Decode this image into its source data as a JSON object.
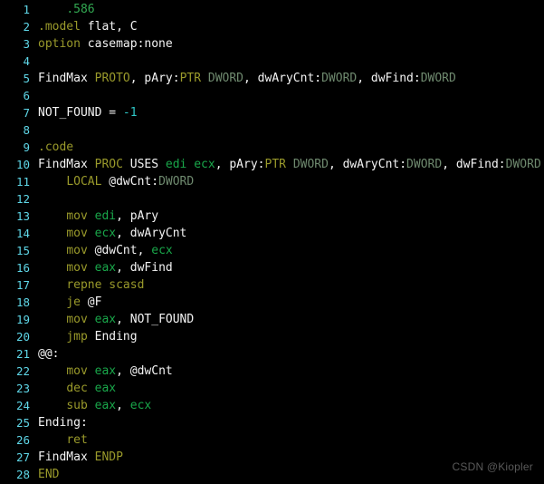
{
  "editor": {
    "language": "masm-assembly",
    "background_color": "#000000",
    "line_count": 28,
    "colors": {
      "background": "#000000",
      "line_number": "#5fd7e8",
      "plain_text": "#f4f4f4",
      "keyword": "#9a9a2b",
      "directive": "#32a852",
      "register": "#19a74a",
      "type": "#6f8a6f",
      "number": "#2ec8c8",
      "watermark": "#5a5a5a"
    }
  },
  "watermark": {
    "text": "CSDN @Kiopler"
  },
  "lines": [
    {
      "number": "1",
      "tokens": [
        {
          "text": "    ",
          "kind": "plain"
        },
        {
          "text": ".586",
          "kind": "directive"
        }
      ]
    },
    {
      "number": "2",
      "tokens": [
        {
          "text": "",
          "kind": "plain"
        },
        {
          "text": ".model",
          "kind": "keyword"
        },
        {
          "text": " flat, C",
          "kind": "plain"
        }
      ]
    },
    {
      "number": "3",
      "tokens": [
        {
          "text": "option",
          "kind": "keyword"
        },
        {
          "text": " casemap:none",
          "kind": "plain"
        }
      ]
    },
    {
      "number": "4",
      "tokens": [
        {
          "text": "",
          "kind": "plain"
        }
      ]
    },
    {
      "number": "5",
      "tokens": [
        {
          "text": "FindMax ",
          "kind": "plain"
        },
        {
          "text": "PROTO",
          "kind": "keyword"
        },
        {
          "text": ", pAry:",
          "kind": "plain"
        },
        {
          "text": "PTR",
          "kind": "keyword"
        },
        {
          "text": " ",
          "kind": "plain"
        },
        {
          "text": "DWORD",
          "kind": "type"
        },
        {
          "text": ", dwAryCnt:",
          "kind": "plain"
        },
        {
          "text": "DWORD",
          "kind": "type"
        },
        {
          "text": ", dwFind:",
          "kind": "plain"
        },
        {
          "text": "DWORD",
          "kind": "type"
        }
      ]
    },
    {
      "number": "6",
      "tokens": [
        {
          "text": "",
          "kind": "plain"
        }
      ]
    },
    {
      "number": "7",
      "tokens": [
        {
          "text": "NOT_FOUND = ",
          "kind": "plain"
        },
        {
          "text": "-1",
          "kind": "number"
        }
      ]
    },
    {
      "number": "8",
      "tokens": [
        {
          "text": "",
          "kind": "plain"
        }
      ]
    },
    {
      "number": "9",
      "tokens": [
        {
          "text": ".code",
          "kind": "keyword"
        }
      ]
    },
    {
      "number": "10",
      "tokens": [
        {
          "text": "FindMax ",
          "kind": "plain"
        },
        {
          "text": "PROC",
          "kind": "keyword"
        },
        {
          "text": " USES ",
          "kind": "plain"
        },
        {
          "text": "edi",
          "kind": "register"
        },
        {
          "text": " ",
          "kind": "plain"
        },
        {
          "text": "ecx",
          "kind": "register"
        },
        {
          "text": ", pAry:",
          "kind": "plain"
        },
        {
          "text": "PTR",
          "kind": "keyword"
        },
        {
          "text": " ",
          "kind": "plain"
        },
        {
          "text": "DWORD",
          "kind": "type"
        },
        {
          "text": ", dwAryCnt:",
          "kind": "plain"
        },
        {
          "text": "DWORD",
          "kind": "type"
        },
        {
          "text": ", dwFind:",
          "kind": "plain"
        },
        {
          "text": "DWORD",
          "kind": "type"
        }
      ]
    },
    {
      "number": "11",
      "tokens": [
        {
          "text": "    ",
          "kind": "plain"
        },
        {
          "text": "LOCAL",
          "kind": "keyword"
        },
        {
          "text": " @dwCnt:",
          "kind": "plain"
        },
        {
          "text": "DWORD",
          "kind": "type"
        }
      ]
    },
    {
      "number": "12",
      "tokens": [
        {
          "text": "",
          "kind": "plain"
        }
      ]
    },
    {
      "number": "13",
      "tokens": [
        {
          "text": "    ",
          "kind": "plain"
        },
        {
          "text": "mov",
          "kind": "keyword"
        },
        {
          "text": " ",
          "kind": "plain"
        },
        {
          "text": "edi",
          "kind": "register"
        },
        {
          "text": ", pAry",
          "kind": "plain"
        }
      ]
    },
    {
      "number": "14",
      "tokens": [
        {
          "text": "    ",
          "kind": "plain"
        },
        {
          "text": "mov",
          "kind": "keyword"
        },
        {
          "text": " ",
          "kind": "plain"
        },
        {
          "text": "ecx",
          "kind": "register"
        },
        {
          "text": ", dwAryCnt",
          "kind": "plain"
        }
      ]
    },
    {
      "number": "15",
      "tokens": [
        {
          "text": "    ",
          "kind": "plain"
        },
        {
          "text": "mov",
          "kind": "keyword"
        },
        {
          "text": " @dwCnt, ",
          "kind": "plain"
        },
        {
          "text": "ecx",
          "kind": "register"
        }
      ]
    },
    {
      "number": "16",
      "tokens": [
        {
          "text": "    ",
          "kind": "plain"
        },
        {
          "text": "mov",
          "kind": "keyword"
        },
        {
          "text": " ",
          "kind": "plain"
        },
        {
          "text": "eax",
          "kind": "register"
        },
        {
          "text": ", dwFind",
          "kind": "plain"
        }
      ]
    },
    {
      "number": "17",
      "tokens": [
        {
          "text": "    ",
          "kind": "plain"
        },
        {
          "text": "repne scasd",
          "kind": "keyword"
        }
      ]
    },
    {
      "number": "18",
      "tokens": [
        {
          "text": "    ",
          "kind": "plain"
        },
        {
          "text": "je",
          "kind": "keyword"
        },
        {
          "text": " @F",
          "kind": "plain"
        }
      ]
    },
    {
      "number": "19",
      "tokens": [
        {
          "text": "    ",
          "kind": "plain"
        },
        {
          "text": "mov",
          "kind": "keyword"
        },
        {
          "text": " ",
          "kind": "plain"
        },
        {
          "text": "eax",
          "kind": "register"
        },
        {
          "text": ", NOT_FOUND",
          "kind": "plain"
        }
      ]
    },
    {
      "number": "20",
      "tokens": [
        {
          "text": "    ",
          "kind": "plain"
        },
        {
          "text": "jmp",
          "kind": "keyword"
        },
        {
          "text": " Ending",
          "kind": "plain"
        }
      ]
    },
    {
      "number": "21",
      "tokens": [
        {
          "text": "@@:",
          "kind": "label"
        }
      ]
    },
    {
      "number": "22",
      "tokens": [
        {
          "text": "    ",
          "kind": "plain"
        },
        {
          "text": "mov",
          "kind": "keyword"
        },
        {
          "text": " ",
          "kind": "plain"
        },
        {
          "text": "eax",
          "kind": "register"
        },
        {
          "text": ", @dwCnt",
          "kind": "plain"
        }
      ]
    },
    {
      "number": "23",
      "tokens": [
        {
          "text": "    ",
          "kind": "plain"
        },
        {
          "text": "dec",
          "kind": "keyword"
        },
        {
          "text": " ",
          "kind": "plain"
        },
        {
          "text": "eax",
          "kind": "register"
        }
      ]
    },
    {
      "number": "24",
      "tokens": [
        {
          "text": "    ",
          "kind": "plain"
        },
        {
          "text": "sub",
          "kind": "keyword"
        },
        {
          "text": " ",
          "kind": "plain"
        },
        {
          "text": "eax",
          "kind": "register"
        },
        {
          "text": ", ",
          "kind": "plain"
        },
        {
          "text": "ecx",
          "kind": "register"
        }
      ]
    },
    {
      "number": "25",
      "tokens": [
        {
          "text": "Ending:",
          "kind": "label"
        }
      ]
    },
    {
      "number": "26",
      "tokens": [
        {
          "text": "    ",
          "kind": "plain"
        },
        {
          "text": "ret",
          "kind": "keyword"
        }
      ]
    },
    {
      "number": "27",
      "tokens": [
        {
          "text": "FindMax ",
          "kind": "plain"
        },
        {
          "text": "ENDP",
          "kind": "keyword"
        }
      ]
    },
    {
      "number": "28",
      "tokens": [
        {
          "text": "END",
          "kind": "keyword"
        }
      ]
    }
  ]
}
